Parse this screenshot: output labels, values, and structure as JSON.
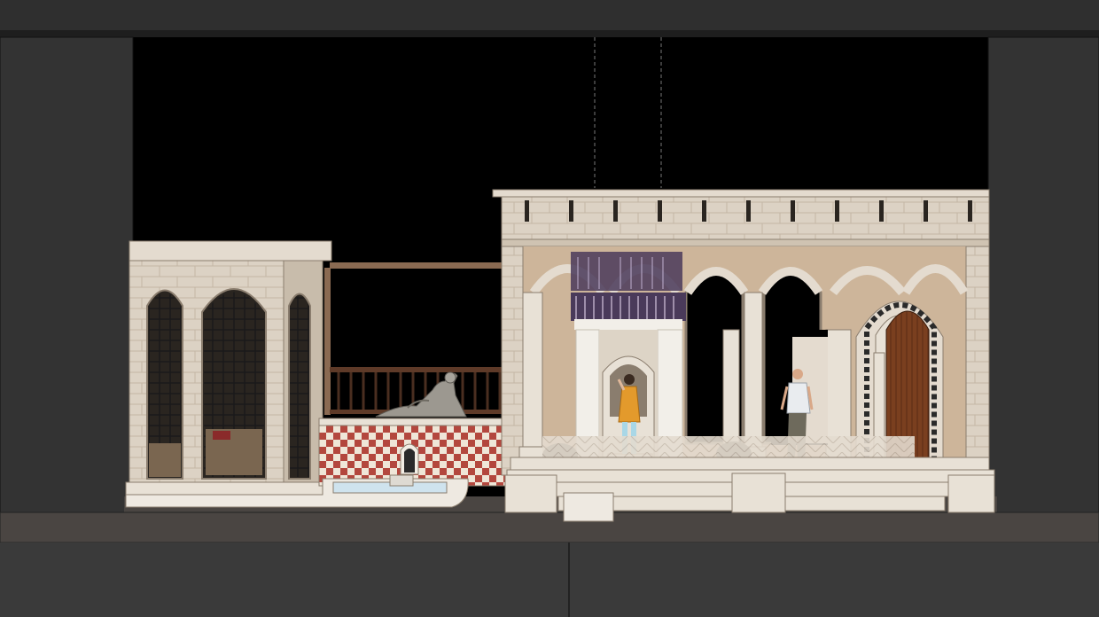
{
  "scene": {
    "colors": {
      "void": "#000000",
      "frame": "#333333",
      "frame_edge": "#1e1e1e",
      "stage_floor": "#4a4542",
      "apron": "#3a3a3a",
      "stone": "#dcd2c4",
      "stone_dark": "#b9ab98",
      "stone_line": "#8a7d6e",
      "wood": "#6e3b1e",
      "tile_red": "#b3473e",
      "tile_cream": "#efe6d8",
      "water": "#cfe3ee",
      "curtain": "#f2efe9",
      "tunic": "#e39a2c",
      "legs": "#a9d7e6"
    },
    "icons": {
      "statue": "reclining-statue-icon",
      "actress": "standing-woman-figure-icon",
      "actor": "walking-man-figure-icon",
      "door": "arched-wooden-door-icon",
      "fountain": "fountain-spout-icon"
    }
  }
}
